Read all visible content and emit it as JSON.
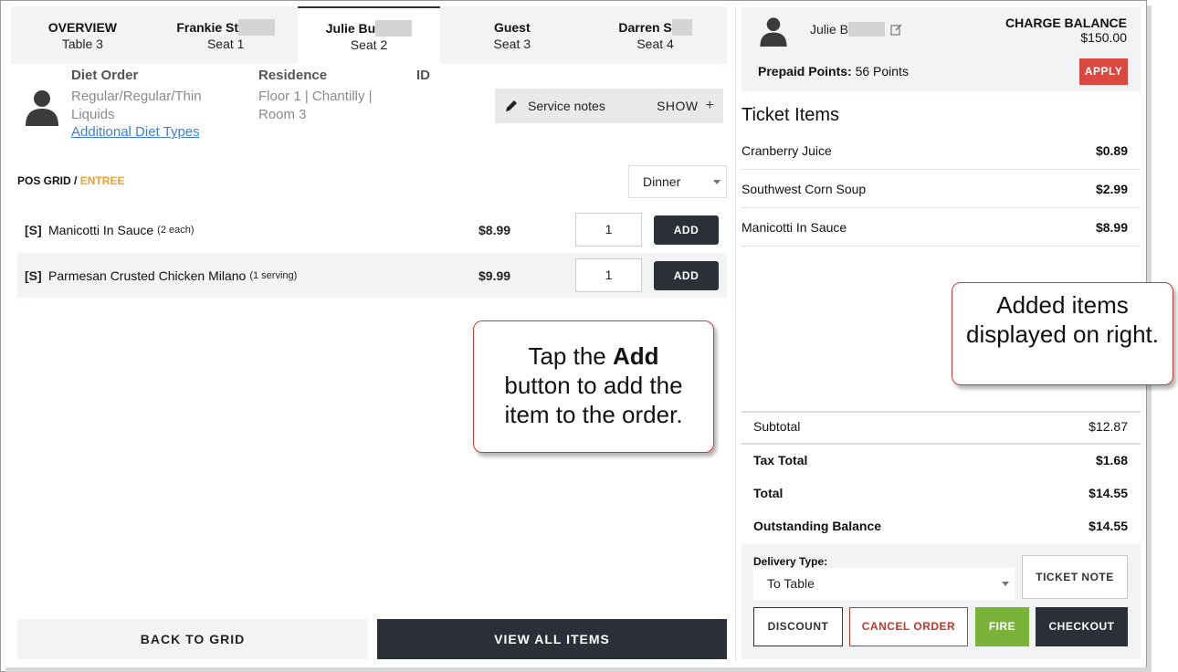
{
  "tabs": [
    {
      "line1": "OVERVIEW",
      "line2": "Table 3",
      "active": false
    },
    {
      "line1": "Frankie St",
      "line2": "Seat 1",
      "active": false
    },
    {
      "line1": "Julie Bu",
      "line2": "Seat 2",
      "active": true
    },
    {
      "line1": "Guest",
      "line2": "Seat 3",
      "active": false
    },
    {
      "line1": "Darren S",
      "line2": "Seat 4",
      "active": false
    }
  ],
  "resident": {
    "diet_heading": "Diet Order",
    "diet_line1": "Regular/Regular/Thin",
    "diet_line2": "Liquids",
    "diet_link": "Additional Diet Types",
    "residence_heading": "Residence",
    "residence_line1": "Floor 1 | Chantilly |",
    "residence_line2": "Room 3",
    "id_heading": "ID"
  },
  "service_notes": {
    "label": "Service notes",
    "toggle": "SHOW",
    "plus": "+"
  },
  "breadcrumb": {
    "root": "POS GRID",
    "sep": " / ",
    "current": "ENTREE"
  },
  "meal_select": {
    "value": "Dinner"
  },
  "menu_items": [
    {
      "code": "[S]",
      "name": "Manicotti In Sauce",
      "portion": "(2 each)",
      "price": "$8.99",
      "qty": "1",
      "add_label": "ADD"
    },
    {
      "code": "[S]",
      "name": "Parmesan Crusted Chicken Milano",
      "portion": "(1 serving)",
      "price": "$9.99",
      "qty": "1",
      "add_label": "ADD"
    }
  ],
  "callouts": {
    "left": {
      "pre": "Tap the ",
      "bold": "Add",
      "post": "button to add the item to the order."
    },
    "right": {
      "text": "Added items displayed on right."
    }
  },
  "bottom_buttons": {
    "back": "BACK TO GRID",
    "view_all": "VIEW ALL ITEMS"
  },
  "right_panel": {
    "name": "Julie B",
    "charge_label": "CHARGE BALANCE",
    "charge_value": "$150.00",
    "prepaid_label": "Prepaid Points:",
    "prepaid_value": "56 Points",
    "apply": "APPLY",
    "ticket_title": "Ticket Items",
    "ticket_items": [
      {
        "name": "Cranberry Juice",
        "price": "$0.89"
      },
      {
        "name": "Southwest Corn Soup",
        "price": "$2.99"
      },
      {
        "name": "Manicotti In Sauce",
        "price": "$8.99"
      }
    ],
    "totals": {
      "subtotal_label": "Subtotal",
      "subtotal": "$12.87",
      "tax_label": "Tax Total",
      "tax": "$1.68",
      "total_label": "Total",
      "total": "$14.55",
      "outstanding_label": "Outstanding Balance",
      "outstanding": "$14.55"
    },
    "delivery_label": "Delivery Type:",
    "delivery_value": "To Table",
    "ticket_note": "TICKET NOTE",
    "discount": "DISCOUNT",
    "cancel_order": "CANCEL ORDER",
    "fire": "FIRE",
    "checkout": "CHECKOUT"
  },
  "colors": {
    "accent_orange": "#f0a030",
    "dark": "#2b2f38",
    "apply_red": "#d9493f",
    "fire_green": "#7bb33a",
    "link_blue": "#3e7fd9"
  }
}
